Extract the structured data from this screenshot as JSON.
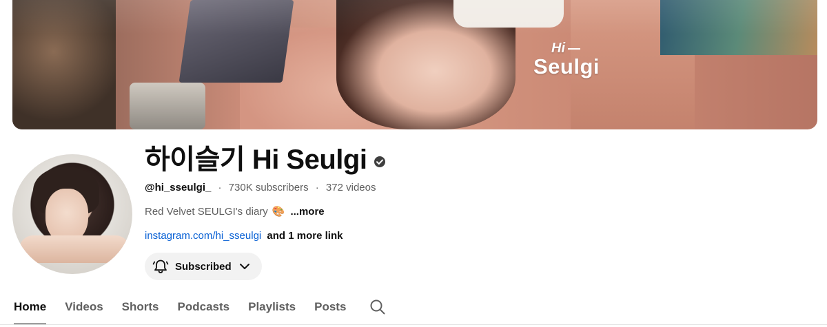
{
  "banner": {
    "logo_small": "Hi",
    "logo_main": "Seulgi"
  },
  "channel": {
    "title": "하이슬기 Hi Seulgi",
    "handle": "@hi_sseulgi_",
    "subscribers": "730K subscribers",
    "videos": "372 videos",
    "separator": "·",
    "description": "Red Velvet SEULGI's diary",
    "description_emoji": "🎨",
    "more_label": "...more",
    "link_text": "instagram.com/hi_sseulgi",
    "more_links_label": "and 1 more link"
  },
  "subscribe_button": {
    "label": "Subscribed",
    "bell_icon": "bell-icon",
    "dropdown_icon": "chevron-down-icon"
  },
  "tabs": [
    {
      "label": "Home",
      "active": true
    },
    {
      "label": "Videos",
      "active": false
    },
    {
      "label": "Shorts",
      "active": false
    },
    {
      "label": "Podcasts",
      "active": false
    },
    {
      "label": "Playlists",
      "active": false
    },
    {
      "label": "Posts",
      "active": false
    }
  ],
  "colors": {
    "link": "#065fd4",
    "text_primary": "#0f0f0f",
    "text_secondary": "#606060",
    "button_bg": "#f2f2f2"
  }
}
